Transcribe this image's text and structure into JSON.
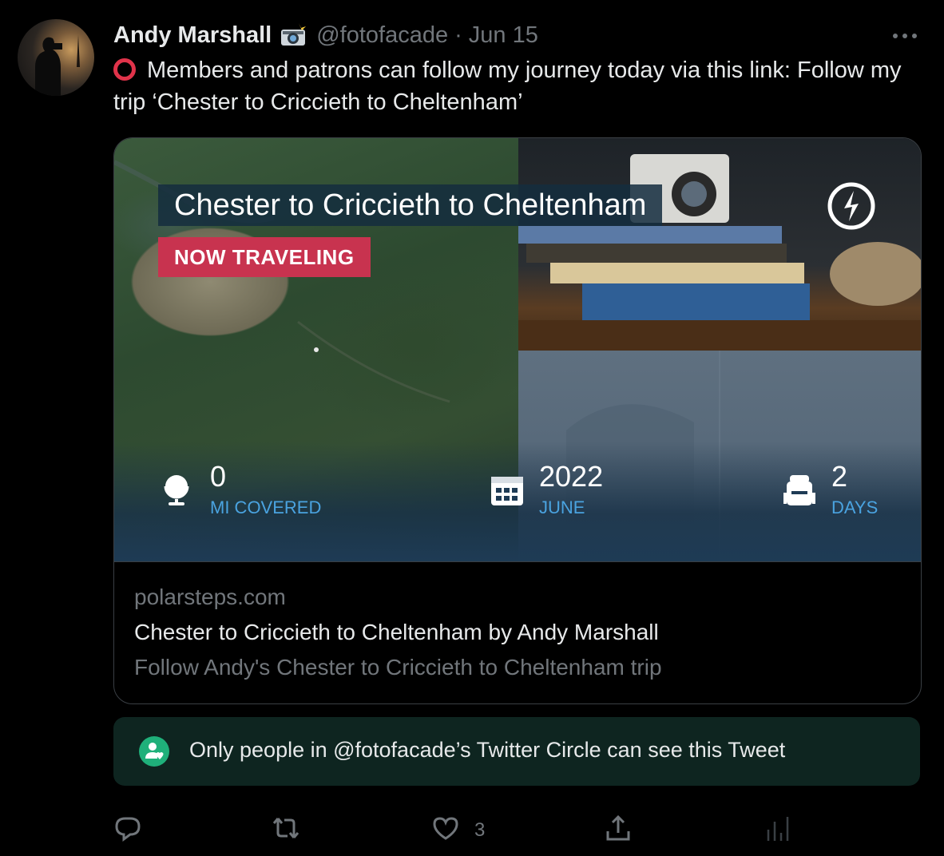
{
  "tweet": {
    "author_name": "Andy Marshall",
    "author_emoji_icon": "camera-with-flash-icon",
    "handle": "@fotofacade",
    "separator": "·",
    "date": "Jun 15",
    "text": "Members and patrons can follow my journey today via this link: Follow my trip ‘Chester to Criccieth to Cheltenham’"
  },
  "card": {
    "media": {
      "trip_title": "Chester to Criccieth to Cheltenham",
      "status_badge": "NOW TRAVELING",
      "stats": [
        {
          "icon": "globe-icon",
          "value": "0",
          "label": "MI COVERED"
        },
        {
          "icon": "calendar-icon",
          "value": "2022",
          "label": "JUNE"
        },
        {
          "icon": "backpack-icon",
          "value": "2",
          "label": "DAYS"
        }
      ]
    },
    "domain": "polarsteps.com",
    "title": "Chester to Criccieth to Cheltenham by Andy Marshall",
    "description": "Follow Andy's Chester to Criccieth to Cheltenham trip"
  },
  "circle_notice": "Only people in @fotofacade’s Twitter Circle can see this Tweet",
  "actions": {
    "reply_count": "",
    "retweet_count": "",
    "like_count": "3",
    "share_count": "",
    "analytics_count": ""
  },
  "colors": {
    "background": "#000000",
    "text_primary": "#e7e9ea",
    "text_secondary": "#71767b",
    "now_traveling_badge": "#c8334f",
    "stat_label_blue": "#4aa3e0",
    "circle_green": "#1fb07a",
    "circle_box_bg": "#0e2520"
  }
}
